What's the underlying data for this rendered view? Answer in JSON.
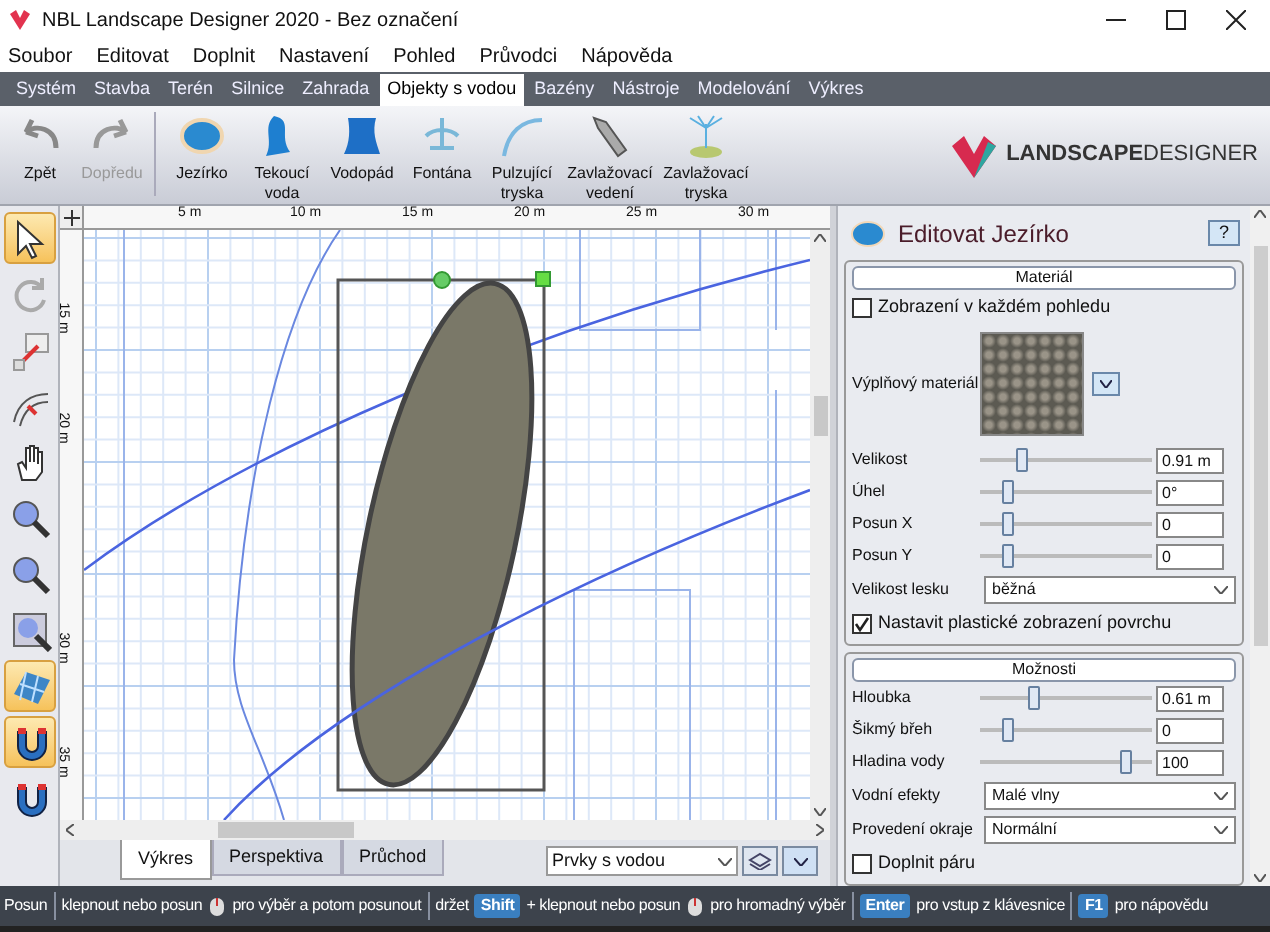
{
  "window": {
    "title": "NBL Landscape Designer 2020 - Bez označení"
  },
  "menu": [
    "Soubor",
    "Editovat",
    "Doplnit",
    "Nastavení",
    "Pohled",
    "Průvodci",
    "Nápověda"
  ],
  "ribbon_tabs": [
    {
      "label": "Systém",
      "selected": false
    },
    {
      "label": "Stavba",
      "selected": false
    },
    {
      "label": "Terén",
      "selected": false
    },
    {
      "label": "Silnice",
      "selected": false
    },
    {
      "label": "Zahrada",
      "selected": false
    },
    {
      "label": "Objekty s vodou",
      "selected": true
    },
    {
      "label": "Bazény",
      "selected": false
    },
    {
      "label": "Nástroje",
      "selected": false
    },
    {
      "label": "Modelování",
      "selected": false
    },
    {
      "label": "Výkres",
      "selected": false
    }
  ],
  "toolbar": [
    {
      "label": "Zpět",
      "kind": "undo",
      "disabled": false
    },
    {
      "label": "Dopředu",
      "kind": "redo",
      "disabled": true
    },
    {
      "label": "Jezírko",
      "kind": "pond",
      "disabled": false
    },
    {
      "label": "Tekoucí voda",
      "kind": "stream",
      "disabled": false
    },
    {
      "label": "Vodopád",
      "kind": "waterfall",
      "disabled": false
    },
    {
      "label": "Fontána",
      "kind": "fountain",
      "disabled": false
    },
    {
      "label": "Pulzující tryska",
      "kind": "jet",
      "disabled": false
    },
    {
      "label": "Zavlažovací vedení",
      "kind": "pipe",
      "disabled": false
    },
    {
      "label": "Zavlažovací tryska",
      "kind": "sprinkler",
      "disabled": false
    }
  ],
  "logo": {
    "text_1": "LANDSCAPE",
    "text_2": "DESIGNER"
  },
  "tools": [
    {
      "kind": "select",
      "on": true
    },
    {
      "kind": "rotate",
      "on": false
    },
    {
      "kind": "line",
      "on": false
    },
    {
      "kind": "arc",
      "on": false
    },
    {
      "kind": "hand",
      "on": false
    },
    {
      "kind": "zoom",
      "on": false
    },
    {
      "kind": "zoom",
      "on": false
    },
    {
      "kind": "zoomwin",
      "on": false
    },
    {
      "kind": "grid",
      "on": true
    },
    {
      "kind": "magnet",
      "on": true
    },
    {
      "kind": "magnet",
      "on": false
    }
  ],
  "ruler_top": [
    "5 m",
    "10 m",
    "15 m",
    "20 m",
    "25 m",
    "30 m"
  ],
  "ruler_left": [
    "15 m",
    "20 m",
    "30 m",
    "35 m"
  ],
  "view_tabs": [
    {
      "label": "Výkres",
      "selected": true
    },
    {
      "label": "Perspektiva",
      "selected": false
    },
    {
      "label": "Průchod",
      "selected": false
    }
  ],
  "layer_select": {
    "value": "Prvky s vodou"
  },
  "panel": {
    "title": "Editovat Jezírko",
    "help": "?",
    "sections": [
      {
        "title": "Materiál",
        "rows": [
          {
            "kind": "checkbox",
            "label": "Zobrazení v každém pohledu",
            "checked": false
          },
          {
            "kind": "material",
            "label": "Výplňový materiál"
          },
          {
            "kind": "slider",
            "label": "Velikost",
            "level": 0.22,
            "value": "0.91 m"
          },
          {
            "kind": "slider",
            "label": "Úhel",
            "level": 0.14,
            "value": "0°"
          },
          {
            "kind": "slider",
            "label": "Posun X",
            "level": 0.14,
            "value": "0"
          },
          {
            "kind": "slider",
            "label": "Posun Y",
            "level": 0.14,
            "value": "0"
          },
          {
            "kind": "select",
            "label": "Velikost lesku",
            "value": "běžná"
          },
          {
            "kind": "checkbox",
            "label": "Nastavit plastické zobrazení povrchu",
            "checked": true
          }
        ]
      },
      {
        "title": "Možnosti",
        "rows": [
          {
            "kind": "slider",
            "label": "Hloubka",
            "level": 0.3,
            "value": "0.61 m"
          },
          {
            "kind": "slider",
            "label": "Šikmý břeh",
            "level": 0.14,
            "value": "0"
          },
          {
            "kind": "slider",
            "label": "Hladina vody",
            "level": 0.87,
            "value": "100"
          },
          {
            "kind": "select",
            "label": "Vodní efekty",
            "value": "Malé vlny"
          },
          {
            "kind": "select",
            "label": "Provedení okraje",
            "value": "Normální"
          },
          {
            "kind": "checkbox",
            "label": "Doplnit páru",
            "checked": false
          }
        ]
      }
    ]
  },
  "status_bar": [
    {
      "kind": "text",
      "text": "Posun"
    },
    {
      "kind": "sep"
    },
    {
      "kind": "text",
      "text": "klepnout nebo posun"
    },
    {
      "kind": "mouse"
    },
    {
      "kind": "text",
      "text": "pro výběr a potom posunout"
    },
    {
      "kind": "sep"
    },
    {
      "kind": "text",
      "text": "držet"
    },
    {
      "kind": "key",
      "text": "Shift"
    },
    {
      "kind": "text",
      "text": "+ klepnout nebo posun"
    },
    {
      "kind": "mouse"
    },
    {
      "kind": "text",
      "text": "pro hromadný výběr"
    },
    {
      "kind": "sep"
    },
    {
      "kind": "key",
      "text": "Enter"
    },
    {
      "kind": "text",
      "text": "pro vstup z klávesnice"
    },
    {
      "kind": "sep"
    },
    {
      "kind": "key",
      "text": "F1"
    },
    {
      "kind": "text",
      "text": "pro nápovědu"
    }
  ]
}
